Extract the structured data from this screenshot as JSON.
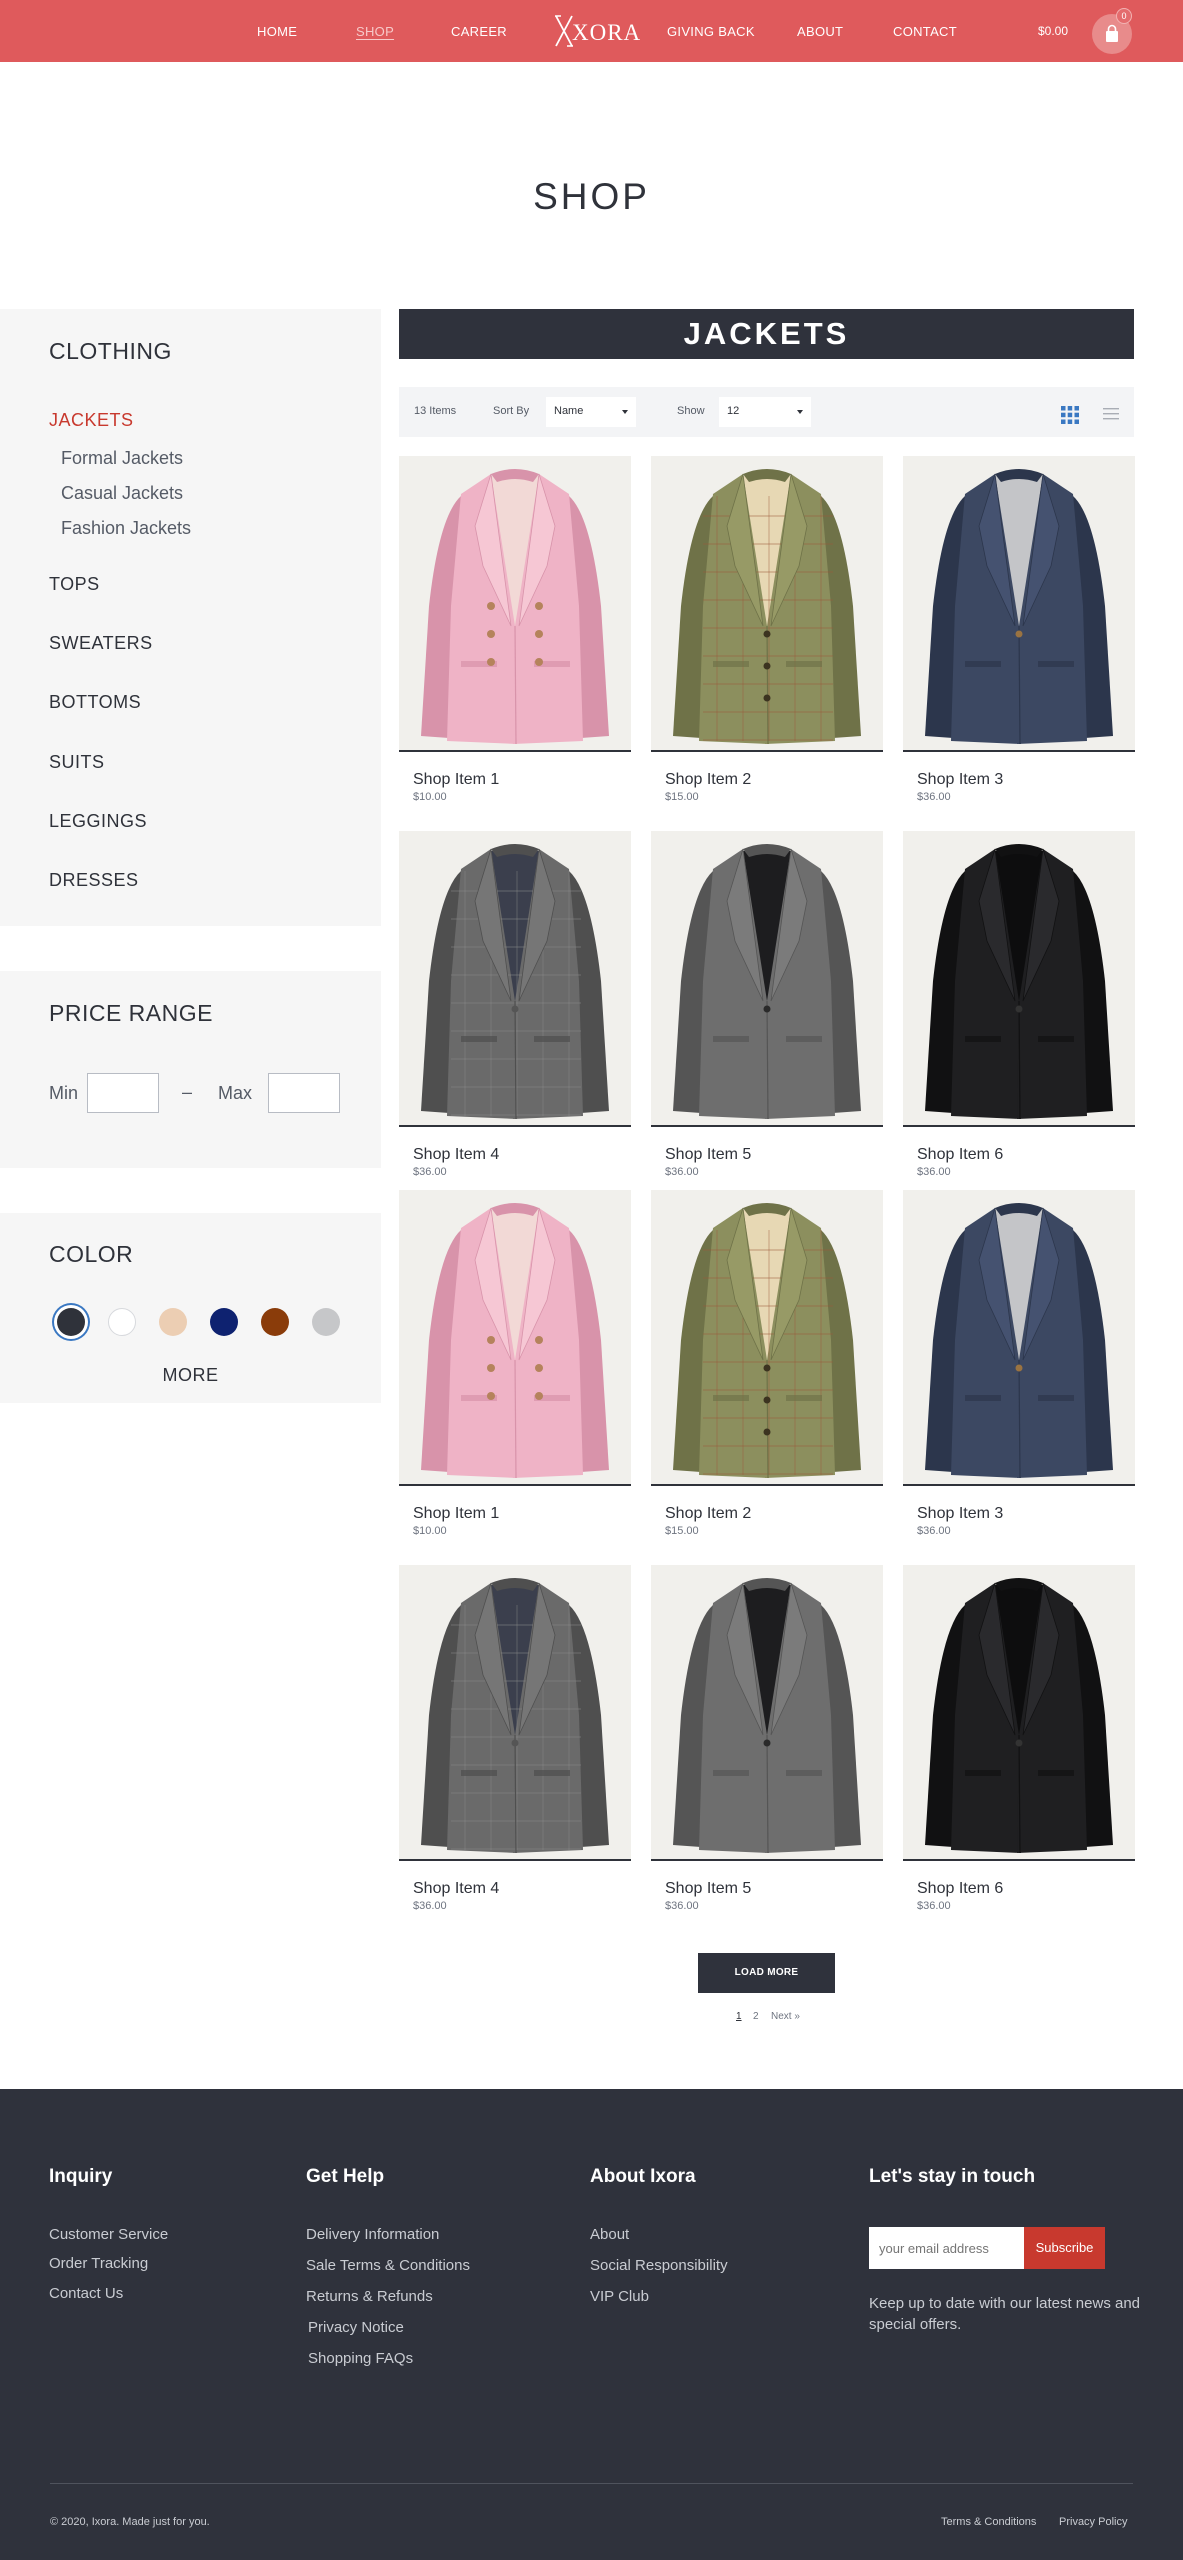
{
  "header": {
    "nav": [
      "HOME",
      "SHOP",
      "CAREER",
      "GIVING BACK",
      "ABOUT",
      "CONTACT"
    ],
    "active_nav": "SHOP",
    "logo_text": "XORA",
    "cart_total": "$0.00",
    "cart_count": "0",
    "brand_color": "#df5a5c"
  },
  "page": {
    "title": "SHOP"
  },
  "sidebar": {
    "clothing_title": "CLOTHING",
    "categories": [
      "JACKETS",
      "TOPS",
      "SWEATERS",
      "BOTTOMS",
      "SUITS",
      "LEGGINGS",
      "DRESSES"
    ],
    "active_category": "JACKETS",
    "subcategories": [
      "Formal Jackets",
      "Casual Jackets",
      "Fashion Jackets"
    ],
    "price_title": "PRICE RANGE",
    "min_label": "Min",
    "max_label": "Max",
    "dash": "–",
    "min_value": "",
    "max_value": "",
    "color_title": "COLOR",
    "swatches": [
      "#2f323a",
      "#ffffff",
      "#ecceb3",
      "#0e2270",
      "#8a3c0a",
      "#c6c7c9"
    ],
    "selected_swatch": 0,
    "more_label": "MORE"
  },
  "main": {
    "banner": "JACKETS",
    "item_count": "13 Items",
    "sort_label": "Sort By",
    "sort_value": "Name",
    "show_label": "Show",
    "show_value": "12",
    "view_mode": "grid",
    "products": [
      {
        "name": "Shop Item 1",
        "price": "$10.00",
        "jacket": "pink"
      },
      {
        "name": "Shop Item 2",
        "price": "$15.00",
        "jacket": "olive-tweed"
      },
      {
        "name": "Shop Item 3",
        "price": "$36.00",
        "jacket": "navy-tweed"
      },
      {
        "name": "Shop Item 4",
        "price": "$36.00",
        "jacket": "grey-check"
      },
      {
        "name": "Shop Item 5",
        "price": "$36.00",
        "jacket": "grey-wool"
      },
      {
        "name": "Shop Item 6",
        "price": "$36.00",
        "jacket": "black"
      },
      {
        "name": "Shop Item 1",
        "price": "$10.00",
        "jacket": "pink"
      },
      {
        "name": "Shop Item 2",
        "price": "$15.00",
        "jacket": "olive-tweed"
      },
      {
        "name": "Shop Item 3",
        "price": "$36.00",
        "jacket": "navy-tweed"
      },
      {
        "name": "Shop Item 4",
        "price": "$36.00",
        "jacket": "grey-check"
      },
      {
        "name": "Shop Item 5",
        "price": "$36.00",
        "jacket": "grey-wool"
      },
      {
        "name": "Shop Item 6",
        "price": "$36.00",
        "jacket": "black"
      }
    ],
    "load_more": "LOAD MORE",
    "pages": [
      "1",
      "2"
    ],
    "current_page": "1",
    "next_label": "Next »"
  },
  "footer": {
    "inquiry_title": "Inquiry",
    "inquiry_links": [
      "Customer Service",
      "Order Tracking",
      "Contact Us"
    ],
    "help_title": "Get Help",
    "help_links": [
      "Delivery Information",
      "Sale Terms & Conditions",
      "Returns & Refunds",
      "Privacy Notice",
      "Shopping FAQs"
    ],
    "about_title": "About Ixora",
    "about_links": [
      "About",
      "Social Responsibility",
      "VIP Club"
    ],
    "touch_title": "Let's stay in touch",
    "email_placeholder": "your email address",
    "subscribe_label": "Subscribe",
    "newsletter_text": "Keep up to date with our latest news and special offers.",
    "copyright": "© 2020, Ixora. Made just for you.",
    "terms": "Terms & Conditions",
    "privacy": "Privacy Policy"
  }
}
